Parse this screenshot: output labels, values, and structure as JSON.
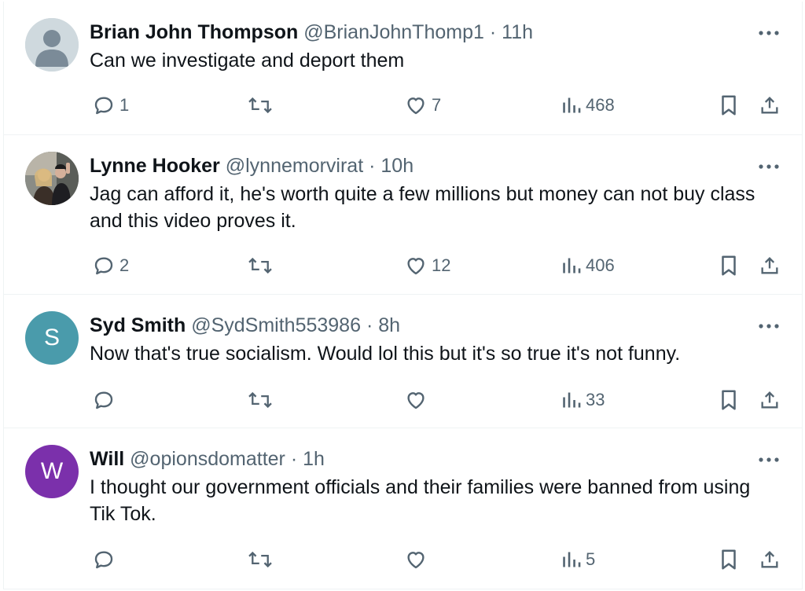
{
  "replies": [
    {
      "name": "Brian John Thompson",
      "handle": "@BrianJohnThomp1",
      "time": "11h",
      "text": "Can we investigate and deport them",
      "reply_count": "1",
      "repost_count": "",
      "like_count": "7",
      "view_count": "468",
      "avatar": {
        "kind": "default",
        "color": "#cfd9de"
      }
    },
    {
      "name": "Lynne Hooker",
      "handle": "@lynnemorvirat",
      "time": "10h",
      "text": "Jag can afford it, he's worth quite a few millions but money can not buy class and this video proves it.",
      "reply_count": "2",
      "repost_count": "",
      "like_count": "12",
      "view_count": "406",
      "avatar": {
        "kind": "photo",
        "color": "#6b6f6a"
      }
    },
    {
      "name": "Syd Smith",
      "handle": "@SydSmith553986",
      "time": "8h",
      "text": "Now that's true socialism. Would lol this but it's so true it's not funny.",
      "reply_count": "",
      "repost_count": "",
      "like_count": "",
      "view_count": "33",
      "avatar": {
        "kind": "letter",
        "letter": "S",
        "color": "#4a9bab"
      }
    },
    {
      "name": "Will",
      "handle": "@opionsdomatter",
      "time": "1h",
      "text": "I thought our government officials and their families were banned from using Tik Tok.",
      "reply_count": "",
      "repost_count": "",
      "like_count": "",
      "view_count": "5",
      "avatar": {
        "kind": "letter",
        "letter": "W",
        "color": "#7b30ab"
      }
    }
  ],
  "separator": "·",
  "icons": [
    "more-icon",
    "reply-icon",
    "repost-icon",
    "like-icon",
    "views-icon",
    "bookmark-icon",
    "share-icon"
  ],
  "colors": {
    "text": "#0f1419",
    "secondary": "#536471",
    "border": "#eff3f4"
  }
}
